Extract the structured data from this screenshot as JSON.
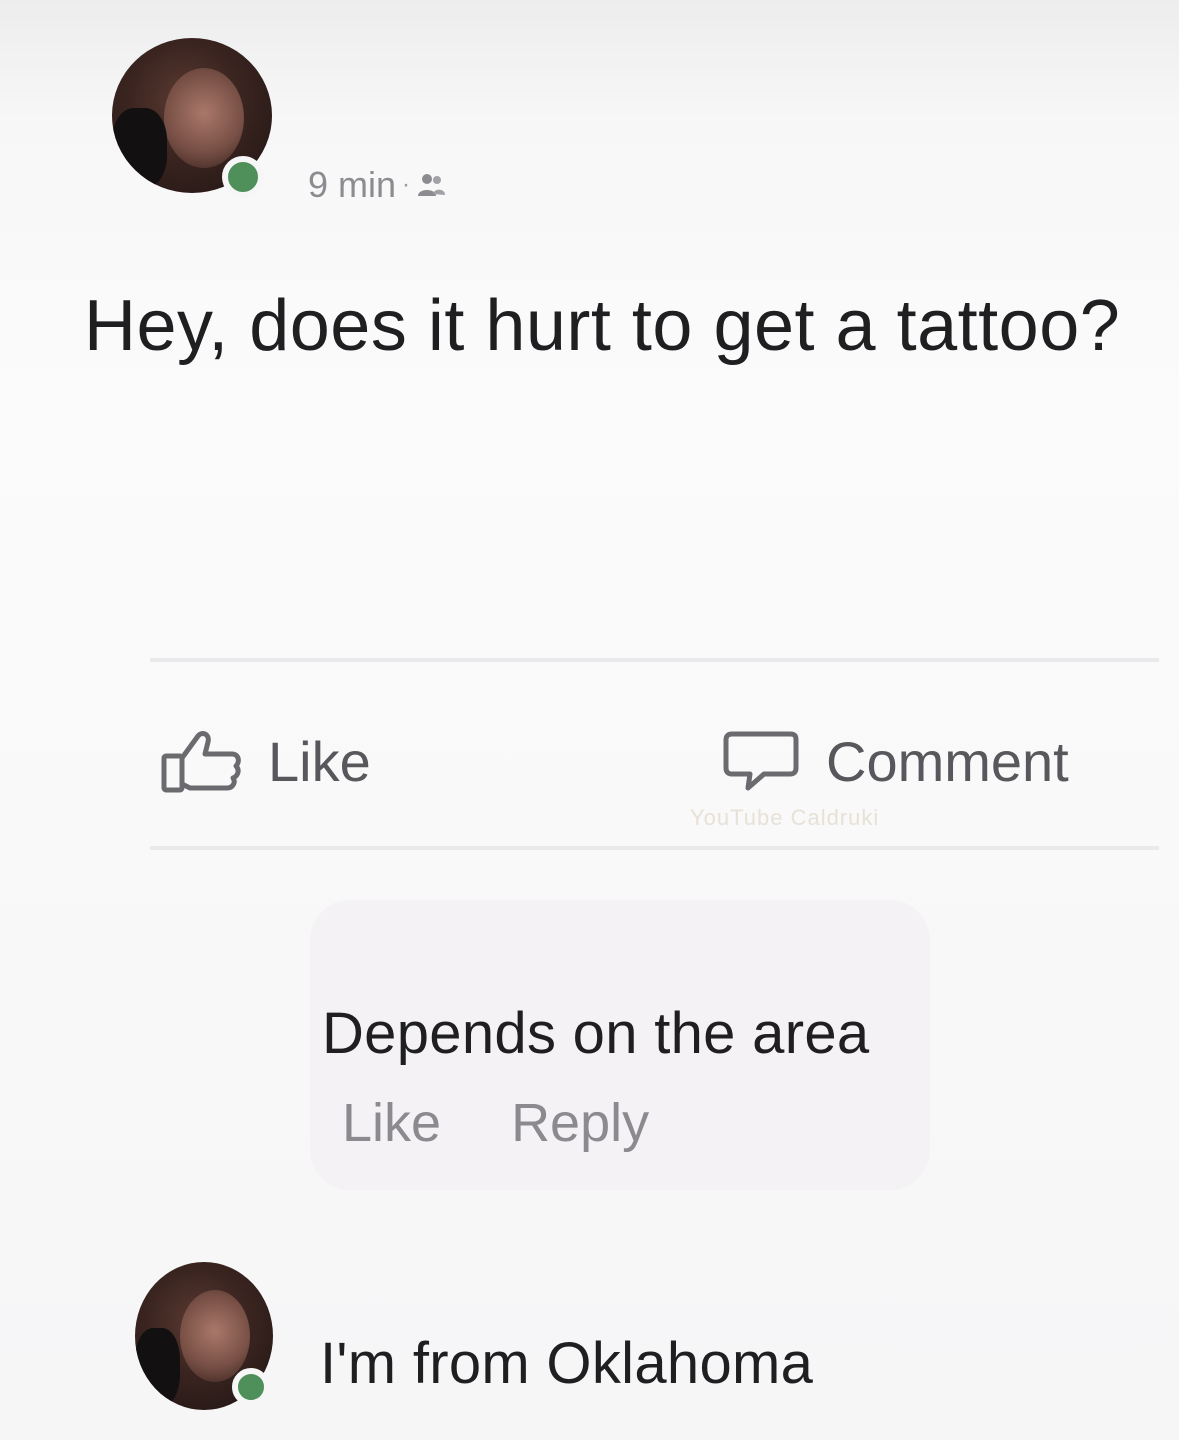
{
  "post": {
    "time": "9 min",
    "separator": "·",
    "audience_icon": "friends-icon",
    "text": "Hey, does it hurt to get a tattoo?"
  },
  "actions": {
    "like_label": "Like",
    "like_icon": "thumbs-up-icon",
    "comment_label": "Comment",
    "comment_icon": "speech-bubble-icon"
  },
  "watermark": "YouTube Caldruki",
  "comments": [
    {
      "text": "Depends on the area",
      "like_label": "Like",
      "reply_label": "Reply"
    },
    {
      "text": "I'm from Oklahoma"
    }
  ],
  "colors": {
    "presence": "#4f8f5a",
    "text": "#1f1f22",
    "muted": "#8a8a8f"
  }
}
